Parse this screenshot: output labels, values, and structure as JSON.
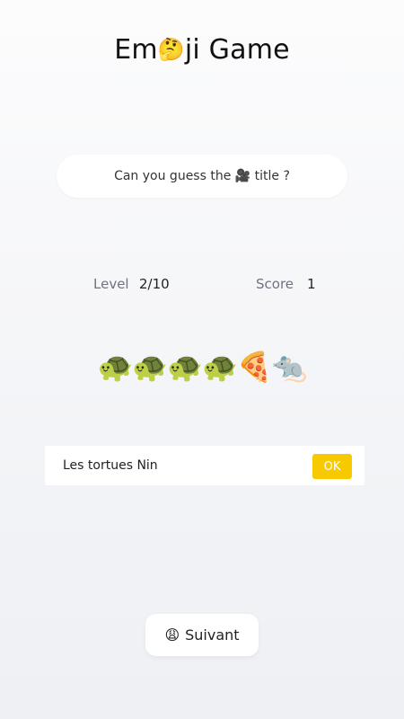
{
  "header": {
    "title_prefix": "Em",
    "title_emoji": "🤔",
    "title_suffix": "ji Game"
  },
  "prompt": {
    "text_before": "Can you guess the ",
    "emoji": "🎥",
    "text_after": " title ?"
  },
  "stats": {
    "level_label": "Level",
    "level_value": "2/10",
    "score_label": "Score",
    "score_value": "1"
  },
  "puzzle": {
    "emojis": [
      "🐢",
      "🐢",
      "🐢",
      "🐢",
      "🍕",
      "🐀"
    ]
  },
  "answer": {
    "value": "Les tortues Nin",
    "ok_label": "OK"
  },
  "next": {
    "icon": "😩",
    "label": "Suivant"
  },
  "colors": {
    "ok_button": "#f7c900",
    "label_gray": "#6f7380"
  }
}
